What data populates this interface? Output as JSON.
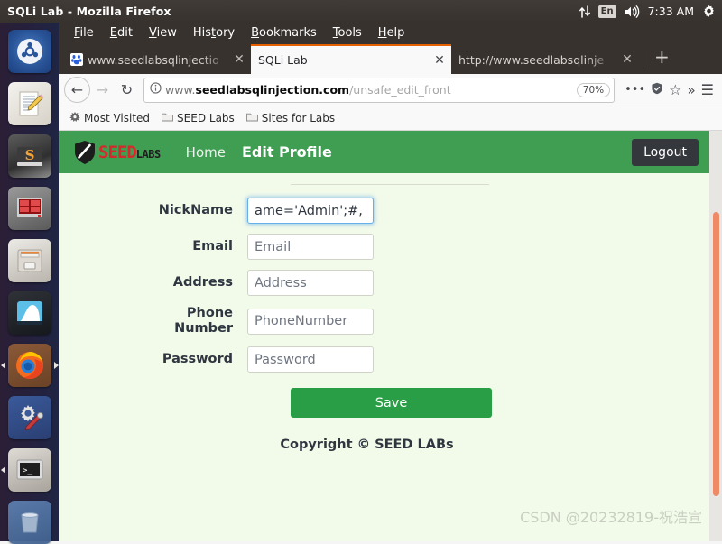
{
  "os_panel": {
    "window_title": "SQLi Lab - Mozilla Firefox",
    "network_icon": "network-updown-icon",
    "keyboard_layout": "En",
    "volume_icon": "volume-icon",
    "clock": "7:33 AM",
    "system_menu_icon": "gear-icon"
  },
  "launcher": {
    "items": [
      {
        "name": "ubuntu-dash",
        "glyph": "⬤",
        "active": false
      },
      {
        "name": "text-editor",
        "glyph": "✎",
        "active": false
      },
      {
        "name": "sublime-text",
        "glyph": "S",
        "active": false
      },
      {
        "name": "terminal-red",
        "glyph": "▤",
        "active": false
      },
      {
        "name": "file-manager",
        "glyph": "☰",
        "active": false
      },
      {
        "name": "wireshark",
        "glyph": "◠",
        "active": false
      },
      {
        "name": "firefox",
        "glyph": "●",
        "active": true
      },
      {
        "name": "system-settings",
        "glyph": "⚙",
        "active": false
      },
      {
        "name": "terminal",
        "glyph": ">_",
        "active": false
      },
      {
        "name": "trash",
        "glyph": "□",
        "active": false
      }
    ]
  },
  "browser": {
    "menus": [
      {
        "label": "File",
        "accel": "F"
      },
      {
        "label": "Edit",
        "accel": "E"
      },
      {
        "label": "View",
        "accel": "V"
      },
      {
        "label": "History",
        "accel": "t"
      },
      {
        "label": "Bookmarks",
        "accel": "B"
      },
      {
        "label": "Tools",
        "accel": "T"
      },
      {
        "label": "Help",
        "accel": "H"
      }
    ],
    "tabs": [
      {
        "label": "www.seedlabsqlinjectio",
        "active": false,
        "favicon": "baidu-paw-icon"
      },
      {
        "label": "SQLi Lab",
        "active": true,
        "favicon": "none"
      },
      {
        "label": "http://www.seedlabsqlinje",
        "active": false,
        "favicon": "none"
      }
    ],
    "new_tab_label": "+",
    "tab_close_label": "✕",
    "nav": {
      "back_label": "←",
      "forward_label": "→",
      "reload_label": "↻"
    },
    "urlbar": {
      "identity_icon": "info-circle-icon",
      "url_prefix": "www.",
      "url_host": "seedlabsqlinjection.com",
      "url_path": "/unsafe_edit_front",
      "zoom_level": "70%",
      "page_actions_icon": "•••",
      "pocket_icon": "shield-icon",
      "bookmark_icon": "☆",
      "overflow_icon": "»",
      "menu_icon": "☰"
    },
    "bookmarks": [
      {
        "label": "Most Visited",
        "icon": "star-burst-icon"
      },
      {
        "label": "SEED Labs",
        "icon": "folder-icon"
      },
      {
        "label": "Sites for Labs",
        "icon": "folder-icon"
      }
    ]
  },
  "site": {
    "brand": {
      "shield_icon": "seed-shield-icon",
      "seed_text": "SEED",
      "labs_text": "LABS"
    },
    "nav": [
      {
        "label": "Home",
        "current": false
      },
      {
        "label": "Edit Profile",
        "current": true
      }
    ],
    "logout_label": "Logout",
    "header_color": "#3f9e52"
  },
  "form": {
    "fields": [
      {
        "label": "NickName",
        "value": "ame='Admin';#,",
        "placeholder": "NickName",
        "focused": true,
        "name": "nickname"
      },
      {
        "label": "Email",
        "value": "",
        "placeholder": "Email",
        "focused": false,
        "name": "email"
      },
      {
        "label": "Address",
        "value": "",
        "placeholder": "Address",
        "focused": false,
        "name": "address"
      },
      {
        "label": "Phone Number",
        "value": "",
        "placeholder": "PhoneNumber",
        "focused": false,
        "name": "phone-number"
      },
      {
        "label": "Password",
        "value": "",
        "placeholder": "Password",
        "focused": false,
        "name": "password"
      }
    ],
    "save_label": "Save",
    "save_color": "#2a9e46"
  },
  "footer": {
    "copyright": "Copyright © SEED LABs"
  },
  "watermark": {
    "text": "CSDN @20232819-祝浩宣"
  }
}
